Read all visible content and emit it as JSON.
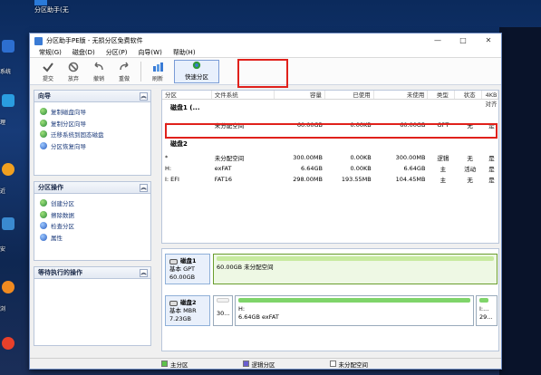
{
  "desktop": {
    "top_label": "分区助手(无",
    "side_labels": [
      "系统",
      "理",
      "近",
      "安",
      "浏"
    ]
  },
  "window": {
    "title": "分区助手PE版 - 无损分区免费软件",
    "controls": [
      "—",
      "□",
      "✕"
    ]
  },
  "menu": [
    "常规(G)",
    "磁盘(D)",
    "分区(P)",
    "向导(W)",
    "帮助(H)"
  ],
  "toolbar": {
    "buttons": [
      {
        "label": "提交",
        "icon": "apply-icon"
      },
      {
        "label": "放弃",
        "icon": "discard-icon"
      },
      {
        "label": "撤销",
        "icon": "undo-icon"
      },
      {
        "label": "重做",
        "icon": "redo-icon"
      },
      {
        "label": "刷新",
        "icon": "refresh-icon"
      }
    ],
    "quick_partition": "快速分区"
  },
  "left": {
    "wizard": {
      "title": "向导",
      "items": [
        "复制磁盘向导",
        "复制分区向导",
        "迁移系统到固态磁盘",
        "分区恢复向导"
      ]
    },
    "partition_ops": {
      "title": "分区操作",
      "items": [
        "创建分区",
        "擦除数据",
        "检查分区",
        "属性"
      ]
    },
    "pending": {
      "title": "等待执行的操作"
    }
  },
  "grid": {
    "headers": [
      "分区",
      "文件系统",
      "容量",
      "已使用",
      "未使用",
      "类型",
      "状态",
      "4KB对齐"
    ],
    "disk1": {
      "title": "磁盘1 (...",
      "rows": [
        [
          "*",
          "未分配空间",
          "60.00GB",
          "0.00KB",
          "60.00GB",
          "GPT",
          "无",
          "是"
        ]
      ]
    },
    "disk2": {
      "title": "磁盘2",
      "rows": [
        [
          "*",
          "未分配空间",
          "300.00MB",
          "0.00KB",
          "300.00MB",
          "逻辑",
          "无",
          "是"
        ],
        [
          "H:",
          "exFAT",
          "6.64GB",
          "0.00KB",
          "6.64GB",
          "主",
          "活动",
          "是"
        ],
        [
          "I: EFI",
          "FAT16",
          "298.00MB",
          "193.55MB",
          "104.45MB",
          "主",
          "无",
          "是"
        ]
      ]
    }
  },
  "map": {
    "disk1": {
      "name": "磁盘1",
      "type": "基本 GPT",
      "size": "60.00GB",
      "segment": "60.00GB 未分配空间"
    },
    "disk2": {
      "name": "磁盘2",
      "type": "基本 MBR",
      "size": "7.23GB",
      "seg_small": "30...",
      "seg_main_line1": "H:",
      "seg_main_line2": "6.64GB exFAT",
      "seg_right": "I:...",
      "seg_right2": "29..."
    }
  },
  "legend": [
    "主分区",
    "逻辑分区",
    "未分配空间"
  ],
  "colors": {
    "highlight": "#e0211b",
    "primary": "#5ec24a",
    "logical": "#6a5fd0",
    "unallocated": "#ffffff",
    "unalloc_bar": "#d4f0b4"
  }
}
